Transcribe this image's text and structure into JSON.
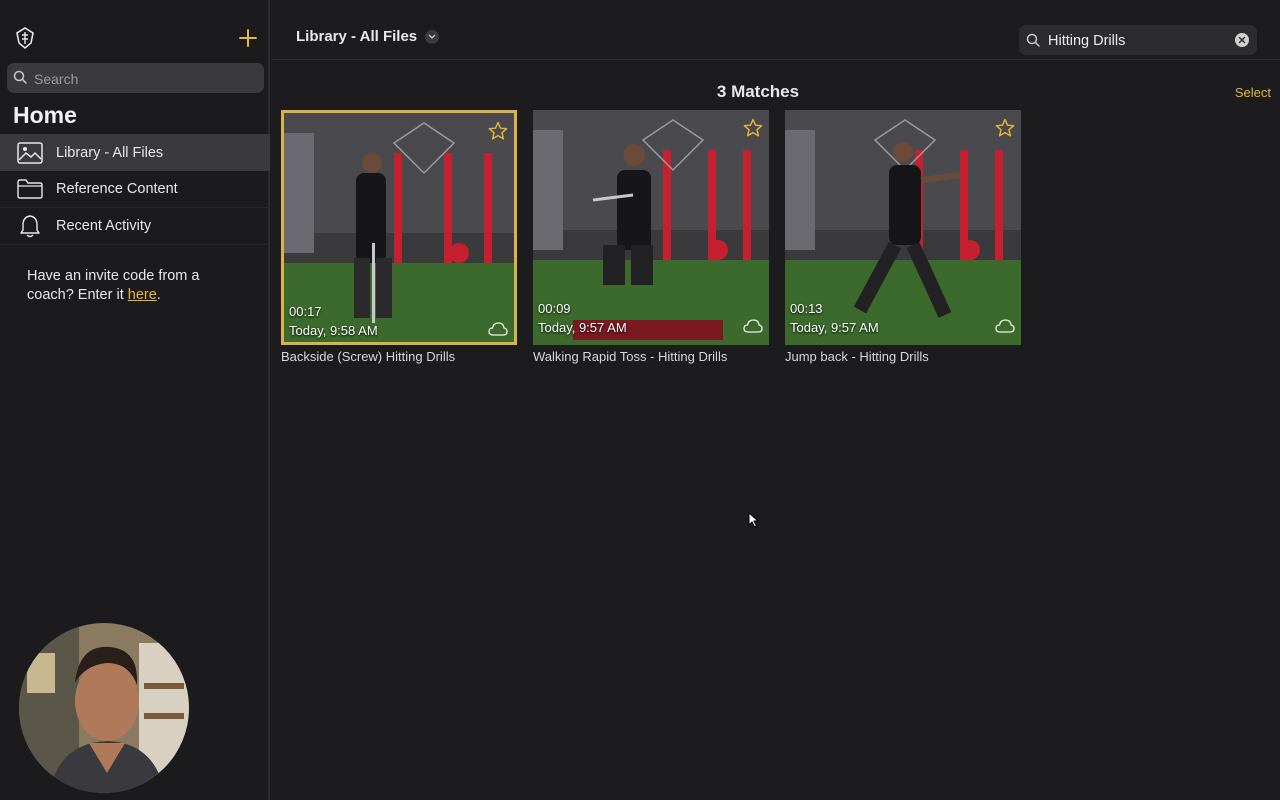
{
  "sidebar": {
    "search_placeholder": "Search",
    "home_title": "Home",
    "items": [
      {
        "label": "Library - All Files",
        "icon": "photo-icon"
      },
      {
        "label": "Reference Content",
        "icon": "folder-icon"
      },
      {
        "label": "Recent Activity",
        "icon": "bell-icon"
      }
    ],
    "invite_text": "Have an invite code from a coach? Enter it ",
    "invite_link": "here",
    "invite_suffix": "."
  },
  "header": {
    "library_title": "Library - All Files",
    "search_value": "Hitting Drills"
  },
  "results": {
    "count_label": "3 Matches",
    "select_label": "Select"
  },
  "videos": [
    {
      "duration": "00:17",
      "date": "Today, 9:58 AM",
      "title": "Backside (Screw) Hitting Drills",
      "selected": true
    },
    {
      "duration": "00:09",
      "date": "Today, 9:57 AM",
      "title": "Walking Rapid Toss - Hitting Drills",
      "selected": false
    },
    {
      "duration": "00:13",
      "date": "Today, 9:57 AM",
      "title": "Jump back - Hitting Drills",
      "selected": false
    }
  ],
  "colors": {
    "accent": "#e6b835",
    "background": "#1c1c1e",
    "sidebar_active": "#3a3a3c"
  }
}
